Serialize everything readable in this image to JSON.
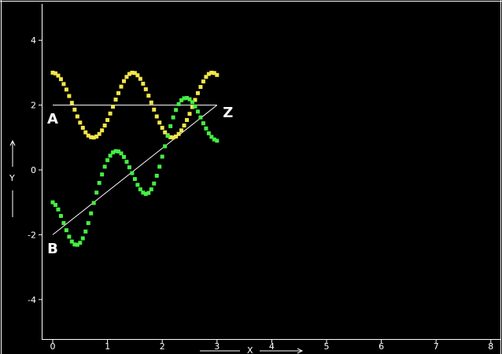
{
  "chart_data": {
    "type": "scatter",
    "xlim": [
      -0.2,
      8.2
    ],
    "ylim": [
      -5.2,
      5.2
    ],
    "xticks": [
      0,
      1,
      2,
      3,
      4,
      5,
      6,
      7,
      8
    ],
    "yticks": [
      -4,
      -2,
      0,
      2,
      4
    ],
    "xlabel": "X",
    "ylabel": "Y",
    "grid": false,
    "background": "#000000",
    "colors": {
      "axes": "#ffffff",
      "series_a": "#f2e64a",
      "series_b": "#44ee44",
      "overlap": "#dd1111",
      "segments": "#ffffff"
    },
    "series": [
      {
        "x": [
          0.0,
          0.05,
          0.1,
          0.15,
          0.2,
          0.25,
          0.3,
          0.35,
          0.4,
          0.45,
          0.5,
          0.55,
          0.6,
          0.65,
          0.7,
          0.75,
          0.8,
          0.85,
          0.9,
          0.95,
          1.0,
          1.05,
          1.1,
          1.15,
          1.2,
          1.25,
          1.3,
          1.35,
          1.4,
          1.45,
          1.5,
          1.55,
          1.6,
          1.65,
          1.7,
          1.75,
          1.8,
          1.85,
          1.9,
          1.95,
          2.0,
          2.05,
          2.1,
          2.15,
          2.2,
          2.25,
          2.3,
          2.35,
          2.4,
          2.45,
          2.5,
          2.55,
          2.6,
          2.65,
          2.7,
          2.75,
          2.8,
          2.85,
          2.9,
          2.95,
          3.0
        ],
        "y": [
          3.0,
          2.98,
          2.91,
          2.8,
          2.65,
          2.48,
          2.28,
          2.07,
          1.86,
          1.65,
          1.46,
          1.3,
          1.16,
          1.06,
          1.01,
          1.0,
          1.03,
          1.11,
          1.22,
          1.37,
          1.54,
          1.74,
          1.95,
          2.17,
          2.37,
          2.57,
          2.74,
          2.87,
          2.96,
          3.0,
          2.99,
          2.92,
          2.81,
          2.66,
          2.49,
          2.29,
          2.08,
          1.86,
          1.65,
          1.46,
          1.3,
          1.16,
          1.07,
          1.01,
          1.0,
          1.03,
          1.11,
          1.22,
          1.37,
          1.54,
          1.73,
          1.94,
          2.16,
          2.37,
          2.56,
          2.73,
          2.87,
          2.96,
          3.0,
          2.99,
          2.93
        ]
      },
      {
        "x": [
          0.0,
          0.05,
          0.1,
          0.15,
          0.2,
          0.25,
          0.3,
          0.35,
          0.4,
          0.45,
          0.5,
          0.55,
          0.6,
          0.65,
          0.7,
          0.75,
          0.8,
          0.85,
          0.9,
          0.95,
          1.0,
          1.05,
          1.1,
          1.15,
          1.2,
          1.25,
          1.3,
          1.35,
          1.4,
          1.45,
          1.5,
          1.55,
          1.6,
          1.65,
          1.7,
          1.75,
          1.8,
          1.85,
          1.9,
          1.95,
          2.0,
          2.05,
          2.1,
          2.15,
          2.2,
          2.25,
          2.3,
          2.35,
          2.4,
          2.45,
          2.5,
          2.55,
          2.6,
          2.65,
          2.7,
          2.75,
          2.8,
          2.85,
          2.9,
          2.95,
          3.0
        ],
        "y": [
          -1.0,
          -1.08,
          -1.22,
          -1.42,
          -1.64,
          -1.86,
          -2.06,
          -2.21,
          -2.3,
          -2.31,
          -2.25,
          -2.11,
          -1.9,
          -1.64,
          -1.34,
          -1.02,
          -0.7,
          -0.4,
          -0.14,
          0.1,
          0.3,
          0.44,
          0.54,
          0.58,
          0.57,
          0.51,
          0.4,
          0.25,
          0.08,
          -0.1,
          -0.28,
          -0.46,
          -0.6,
          -0.7,
          -0.74,
          -0.71,
          -0.6,
          -0.42,
          -0.18,
          0.1,
          0.41,
          0.73,
          1.05,
          1.35,
          1.62,
          1.85,
          2.03,
          2.15,
          2.21,
          2.22,
          2.18,
          2.09,
          1.96,
          1.8,
          1.62,
          1.44,
          1.28,
          1.13,
          1.02,
          0.94,
          0.9
        ]
      }
    ],
    "segments": [
      {
        "x": [
          0,
          3
        ],
        "y": [
          2,
          2
        ]
      },
      {
        "x": [
          0,
          3
        ],
        "y": [
          -2,
          2
        ]
      }
    ],
    "point_labels": [
      {
        "text": "A",
        "x": 0.0,
        "y": 1.6
      },
      {
        "text": "B",
        "x": 0.0,
        "y": -2.4
      },
      {
        "text": "Z",
        "x": 3.2,
        "y": 1.8
      }
    ]
  }
}
